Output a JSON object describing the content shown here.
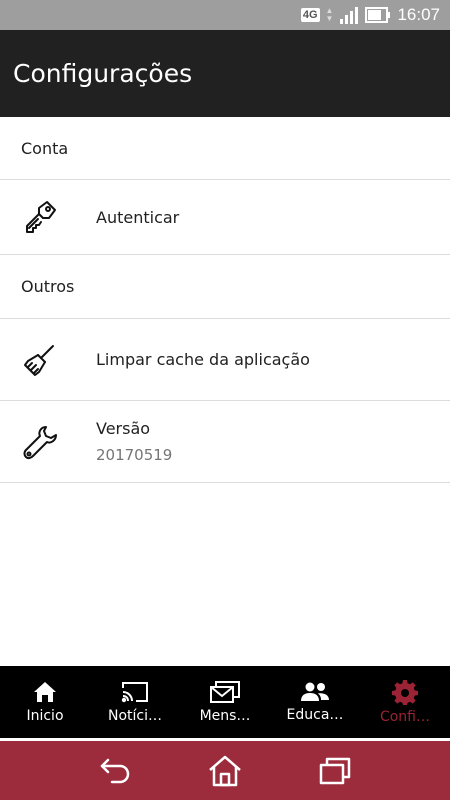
{
  "status": {
    "network": "4G",
    "time": "16:07"
  },
  "app_bar": {
    "title": "Configurações"
  },
  "sections": {
    "account": {
      "header": "Conta",
      "items": [
        {
          "title": "Autenticar"
        }
      ]
    },
    "others": {
      "header": "Outros",
      "items": [
        {
          "title": "Limpar cache da aplicação"
        },
        {
          "title": "Versão",
          "subtitle": "20170519"
        }
      ]
    }
  },
  "bottom_nav": {
    "items": [
      {
        "label": "Inicio",
        "icon": "home-icon"
      },
      {
        "label": "Notíci…",
        "icon": "cast-icon"
      },
      {
        "label": "Mens…",
        "icon": "messages-icon"
      },
      {
        "label": "Educa…",
        "icon": "people-icon"
      },
      {
        "label": "Confi…",
        "icon": "gear-icon"
      }
    ],
    "active_index": 4,
    "active_color": "#9b2335"
  },
  "system_nav": {
    "background": "#9c2b3c",
    "buttons": [
      "back-icon",
      "home-icon",
      "recent-apps-icon"
    ]
  }
}
